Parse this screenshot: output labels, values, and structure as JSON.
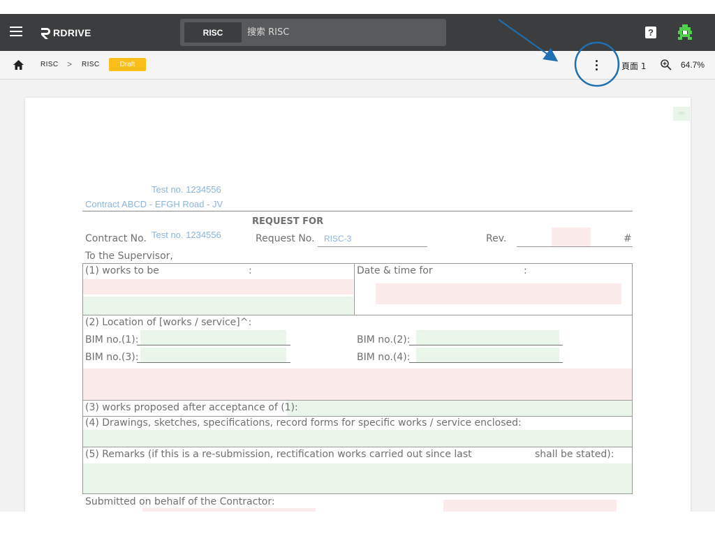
{
  "app": {
    "brand": "RDRIVE",
    "search_scope": "RISC",
    "search_placeholder": "搜索 RISC",
    "help_icon_glyph": "?",
    "icons": [
      "menu-icon",
      "logo-icon",
      "help-icon",
      "avatar-icon",
      "home-icon",
      "more-vert-icon",
      "zoom-icon"
    ]
  },
  "toolbar": {
    "breadcrumb": [
      "RISC",
      "RISC"
    ],
    "separator": ">",
    "status_badge": "Draft",
    "page_label": "頁面 1",
    "zoom": "64.7%"
  },
  "colors": {
    "topbar": "#3b3d3f",
    "badge": "#fbbd1a",
    "annotation": "#1f6fb2",
    "field_pink": "#fcebeb",
    "field_green": "#ebf6eb"
  },
  "document": {
    "page_tag": "oo",
    "header_test_no": "Test no. 1234556",
    "header_contract": "Contract ABCD - EFGH Road - JV",
    "title": "REQUEST FOR",
    "contract_no_label": "Contract No.",
    "contract_no_value": "Test no. 1234556",
    "request_no_label": "Request No.",
    "request_no_value": "RISC-3",
    "rev_label": "Rev.",
    "hash": "#",
    "addressee": "To the Supervisor,",
    "s1_label": "(1) works to be",
    "s1_colon": ":",
    "date_label": "Date & time for",
    "date_colon": ":",
    "s2_label": "(2) Location of [works / service]^:",
    "bim1": "BIM no.(1):",
    "bim2": "BIM no.(2):",
    "bim3": "BIM no.(3):",
    "bim4": "BIM no.(4):",
    "s3_label": "(3) works proposed after acceptance of (1):",
    "s4_label": "(4) Drawings, sketches, specifications, record forms for specific works / service enclosed:",
    "s5_label": "(5) Remarks (if this is a re-submission, rectification works carried out since last",
    "s5_tail": "shall be stated):",
    "submitted": "Submitted on behalf of the Contractor:"
  }
}
